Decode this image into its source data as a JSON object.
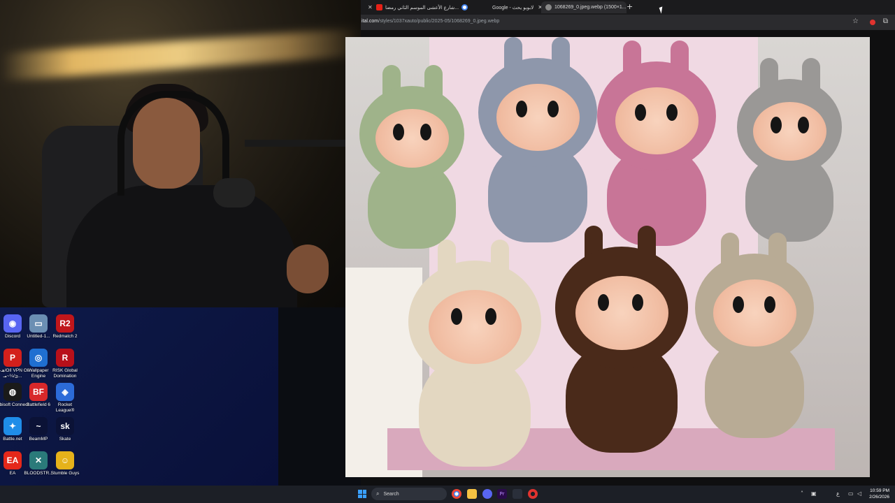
{
  "browser": {
    "tabs": [
      {
        "label": "",
        "favicon": "close-icon"
      },
      {
        "label": "شارع الأعشى الموسم الثاني رمضا...",
        "favicon": "youtube-icon",
        "color": "#e62117"
      },
      {
        "label": "",
        "favicon": "google-icon"
      },
      {
        "label": "Google - لابوبو يحث",
        "favicon": "google-icon"
      },
      {
        "label": "1068269_0.jpeg.webp (1500×1...",
        "favicon": "globe-icon",
        "active": true
      }
    ],
    "url_domain": "ital.com",
    "url_path": "/styles/1037xauto/public/2025-05/1068269_0.jpeg.webp"
  },
  "desktop_icons": [
    {
      "label": "Discord",
      "icon": "discord-icon",
      "color": "#5865f2",
      "glyph": "◉"
    },
    {
      "label": "Untitled-1...",
      "icon": "file-icon",
      "color": "#6b8fb3",
      "glyph": "▭"
    },
    {
      "label": "Redmatch 2",
      "icon": "redmatch-icon",
      "color": "#c0161b",
      "glyph": "R2"
    },
    {
      "label": "هـ-ئ/Olا VPN Ol/ئ/¼~مـ...",
      "icon": "vpn-icon",
      "color": "#d3201c",
      "glyph": "P"
    },
    {
      "label": "Wallpaper Engine",
      "icon": "wallpaper-engine-icon",
      "color": "#1f6fd1",
      "glyph": "◎"
    },
    {
      "label": "RISK Global Domination",
      "icon": "risk-icon",
      "color": "#b8101a",
      "glyph": "R"
    },
    {
      "label": "Ubisoft Connect",
      "icon": "ubisoft-icon",
      "color": "#1a1a1a",
      "glyph": "◍"
    },
    {
      "label": "Battlefield 6",
      "icon": "battlefield-icon",
      "color": "#d8282a",
      "glyph": "BF"
    },
    {
      "label": "Rocket League®",
      "icon": "rocket-league-icon",
      "color": "#2c6bd8",
      "glyph": "◈"
    },
    {
      "label": "Battle.net",
      "icon": "battlenet-icon",
      "color": "#1f8de8",
      "glyph": "✦"
    },
    {
      "label": "BeamMP",
      "icon": "beammp-icon",
      "color": "#0b1236",
      "glyph": "~"
    },
    {
      "label": "Skate",
      "icon": "skate-icon",
      "color": "#0b1236",
      "glyph": "sk"
    },
    {
      "label": "EA",
      "icon": "ea-icon",
      "color": "#e5281a",
      "glyph": "EA"
    },
    {
      "label": "BLOODSTR...",
      "icon": "bloodstrike-icon",
      "color": "#2a7a7a",
      "glyph": "✕"
    },
    {
      "label": "Stumble Guys",
      "icon": "stumble-guys-icon",
      "color": "#e6b21a",
      "glyph": "☺"
    }
  ],
  "taskbar": {
    "search_label": "Search",
    "clock_time": "10:59 PM",
    "clock_date": "2/26/2026",
    "lang": "ع"
  },
  "colors": {
    "accent_blue": "#3aa0ff",
    "tab_bar": "#1b1b1d",
    "desktop": "#0c1540"
  }
}
